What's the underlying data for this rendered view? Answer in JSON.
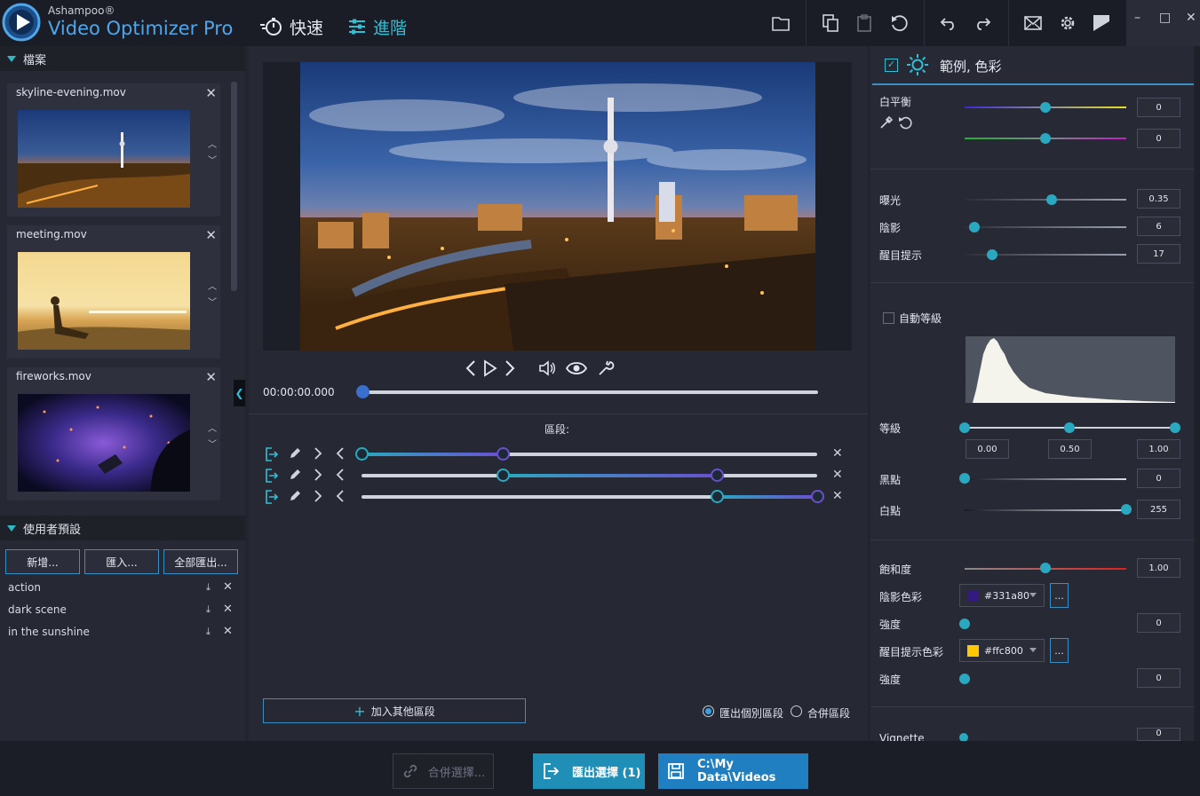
{
  "app": {
    "brand": "Ashampoo®",
    "name": "Video Optimizer Pro"
  },
  "modes": {
    "fast": "快速",
    "advanced": "進階"
  },
  "window_controls": {
    "minimize": "–",
    "maximize": "□",
    "close": "✕"
  },
  "files_section": {
    "title": "檔案",
    "files": [
      {
        "name": "skyline-evening.mov"
      },
      {
        "name": "meeting.mov"
      },
      {
        "name": "fireworks.mov"
      }
    ]
  },
  "presets_section": {
    "title": "使用者預設",
    "buttons": {
      "new": "新增...",
      "import": "匯入...",
      "export_all": "全部匯出..."
    },
    "items": [
      "action",
      "dark scene",
      "in the sunshine"
    ]
  },
  "player": {
    "timecode": "00:00:00.000",
    "progress": 0.0
  },
  "segments": {
    "title": "區段:",
    "rows": [
      {
        "start": 0.0,
        "end": 0.31
      },
      {
        "start": 0.31,
        "end": 0.78
      },
      {
        "start": 0.78,
        "end": 1.0
      }
    ],
    "add_label": "加入其他區段",
    "export_individual": "匯出個別區段",
    "merge": "合併區段",
    "selected_mode": "export_individual"
  },
  "panel": {
    "title": "範例, 色彩",
    "checked": true,
    "white_balance": {
      "label": "白平衡",
      "blue_yellow": "0",
      "green_magenta": "0",
      "blue_yellow_pos": 0.5,
      "green_magenta_pos": 0.5
    },
    "exposure": {
      "label": "曝光",
      "value": "0.35",
      "pos": 0.54
    },
    "shadows": {
      "label": "陰影",
      "value": "6",
      "pos": 0.06
    },
    "highlights": {
      "label": "醒目提示",
      "value": "17",
      "pos": 0.17
    },
    "auto_levels": {
      "label": "自動等級",
      "checked": false
    },
    "levels": {
      "label": "等級",
      "low": "0.00",
      "mid": "0.50",
      "high": "1.00"
    },
    "black_point": {
      "label": "黑點",
      "value": "0",
      "pos": 0.0
    },
    "white_point": {
      "label": "白點",
      "value": "255",
      "pos": 1.0
    },
    "saturation": {
      "label": "飽和度",
      "value": "1.00",
      "pos": 0.5
    },
    "shadow_color": {
      "label": "陰影色彩",
      "hex": "#331a80",
      "more": "..."
    },
    "shadow_strength": {
      "label": "強度",
      "value": "0",
      "pos": 0.0
    },
    "highlight_color": {
      "label": "醒目提示色彩",
      "hex": "#ffc800",
      "more": "..."
    },
    "highlight_strength": {
      "label": "強度",
      "value": "0",
      "pos": 0.0
    },
    "vignette": {
      "label": "Vignette",
      "value": "0"
    }
  },
  "bottom": {
    "merge_selection": "合併選擇...",
    "export_selection": "匯出選擇 (1)",
    "output_path": "C:\\My Data\\Videos"
  },
  "colors": {
    "accent": "#2aa8c0",
    "button_blue": "#1f8fb8",
    "export_blue": "#1f7fc0",
    "segment_purple": "#6a4fd0"
  }
}
